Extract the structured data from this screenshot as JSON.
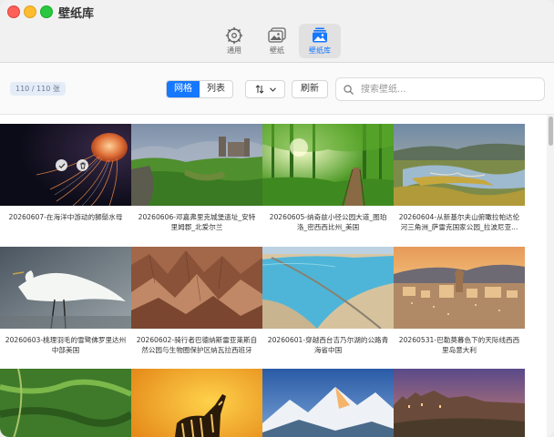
{
  "window": {
    "title": "壁纸库"
  },
  "tabs": [
    {
      "label": "通用",
      "icon": "gear-icon"
    },
    {
      "label": "壁纸",
      "icon": "photos-icon"
    },
    {
      "label": "壁纸库",
      "icon": "gallery-icon",
      "active": true
    }
  ],
  "controls": {
    "count": "110 / 110 张",
    "view_grid": "网格",
    "view_list": "列表",
    "sort_icon": "sort-arrows-icon",
    "refresh": "刷新",
    "search_placeholder": "搜索壁纸..."
  },
  "wallpapers": [
    {
      "caption": "20260607-在海洋中游动的狮鬃水母",
      "scene": "jellyfish"
    },
    {
      "caption": "20260606-邓嘉弗里克城堡遗址_安特里姆郡_北爱尔兰",
      "scene": "castle"
    },
    {
      "caption": "20260605-纳奇兹小径公园大道_图珀洛_密西西比州_美国",
      "scene": "forest"
    },
    {
      "caption": "20260604-从新基尔夫山俯瞰拉帕达伦河三角洲_萨雷克国家公园_拉波尼亚...",
      "scene": "delta"
    },
    {
      "caption": "20260603-桃理羽毛的雪鹭佛罗里达州中部美国",
      "scene": "egret"
    },
    {
      "caption": "20260602-骑行者巴德纳斯雷亚莱斯自然公园与生物圈保护区纳瓦拉西班牙",
      "scene": "badlands"
    },
    {
      "caption": "20260601-穿越西台吉乃尔湖的公路青海省中国",
      "scene": "lake"
    },
    {
      "caption": "20260531-巴勒莫暮色下的天际线西西里岛意大利",
      "scene": "city"
    },
    {
      "caption": "",
      "scene": "aerial"
    },
    {
      "caption": "",
      "scene": "zebra"
    },
    {
      "caption": "",
      "scene": "mountain"
    },
    {
      "caption": "",
      "scene": "castle2"
    }
  ],
  "colors": {
    "accent": "#1677ff"
  }
}
